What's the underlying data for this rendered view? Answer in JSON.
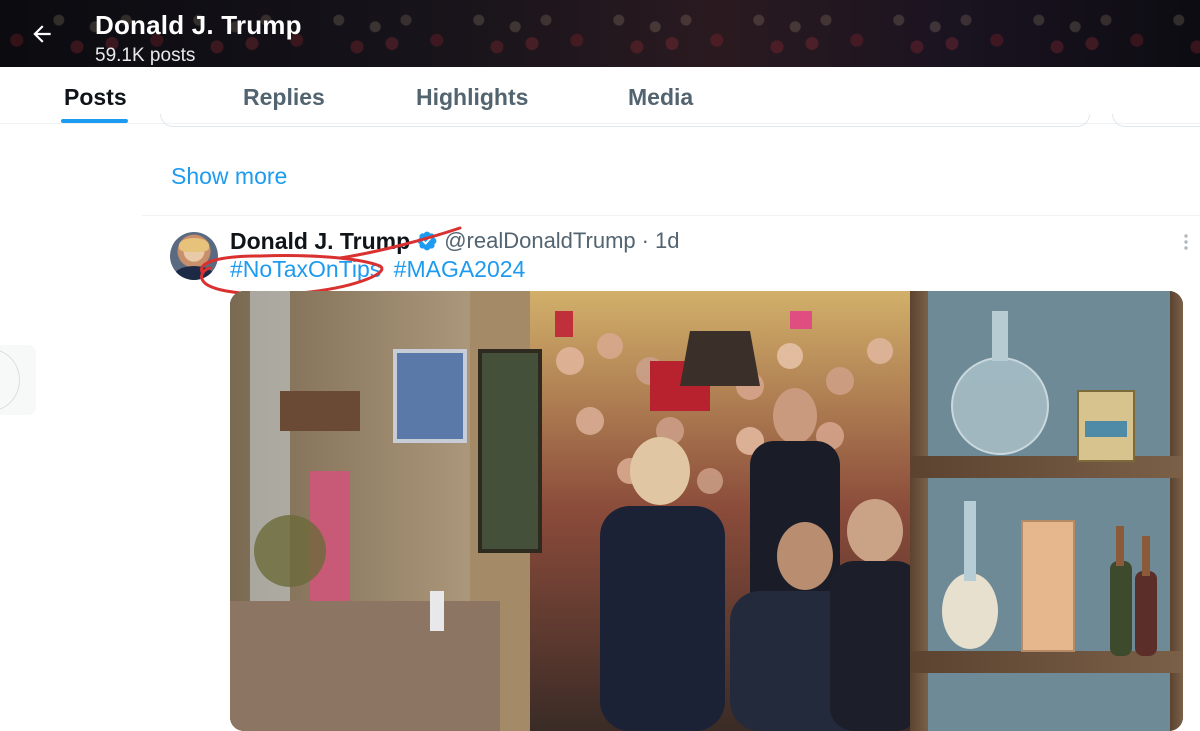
{
  "header": {
    "title": "Donald J. Trump",
    "post_count": "59.1K posts"
  },
  "tabs": [
    {
      "label": "Posts",
      "active": true
    },
    {
      "label": "Replies",
      "active": false
    },
    {
      "label": "Highlights",
      "active": false
    },
    {
      "label": "Media",
      "active": false
    }
  ],
  "feed": {
    "show_more_label": "Show more"
  },
  "post": {
    "author_name": "Donald J. Trump",
    "handle": "@realDonaldTrump",
    "separator": "·",
    "time": "1d",
    "hashtags": [
      "#NoTaxOnTips",
      "#MAGA2024"
    ],
    "media_icon": "video-thumbnail",
    "verified_icon": "verified-badge-icon"
  },
  "colors": {
    "accent": "#1d9bf0",
    "text_primary": "#0f1419",
    "text_secondary": "#536471",
    "annotation": "#d8312f"
  }
}
